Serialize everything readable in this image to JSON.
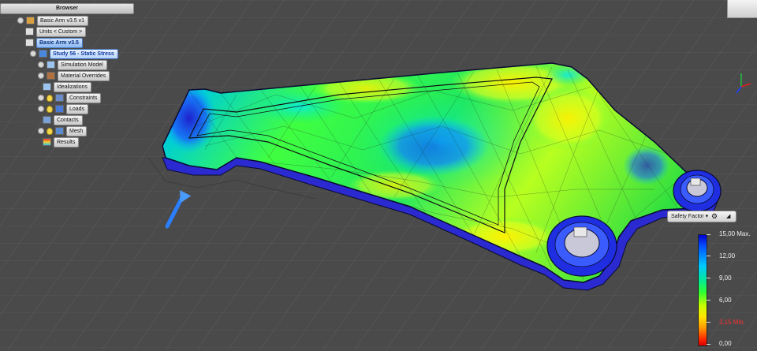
{
  "browser": {
    "title": "Browser",
    "items": [
      {
        "label": "Basic Arm v3.5 v1"
      },
      {
        "label": "Units < Custom >"
      },
      {
        "label": "Basic Arm v3.5"
      },
      {
        "label": "Study 56 - Static Stress"
      },
      {
        "label": "Simulation Model"
      },
      {
        "label": "Material Overrides"
      },
      {
        "label": "Idealizations"
      },
      {
        "label": "Constraints"
      },
      {
        "label": "Loads"
      },
      {
        "label": "Contacts"
      },
      {
        "label": "Mesh"
      },
      {
        "label": "Results"
      }
    ]
  },
  "result_control": {
    "label": "Safety Factor ▾",
    "gear": "⚙",
    "pin": "◢"
  },
  "legend": {
    "values": [
      "15,00 Max.",
      "12,00",
      "9,00",
      "6,00",
      "3,15 Min.",
      "0,00"
    ]
  },
  "colors": {
    "background": "#4a4a4a",
    "grid": "#5a5a5a",
    "part_edge": "#0a0a30",
    "load_arrow": "#2a7fff"
  },
  "icons": [
    "viewcube-icon",
    "axis-triad-icon",
    "load-arrow-icon",
    "gear-icon",
    "pin-icon"
  ]
}
